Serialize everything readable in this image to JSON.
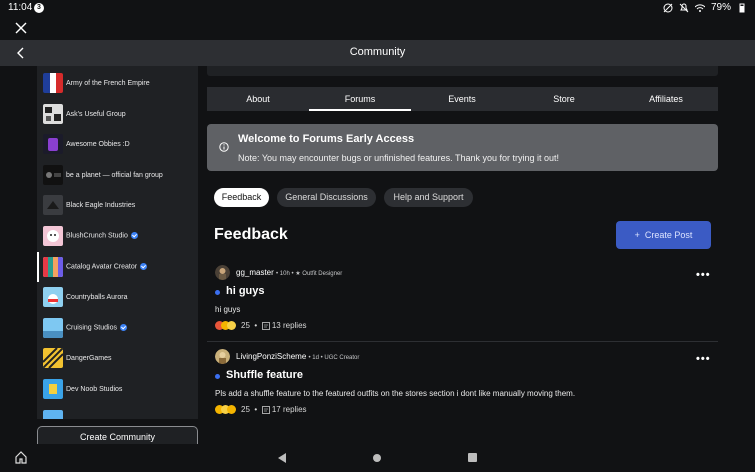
{
  "status_bar": {
    "time": "11:04",
    "notification_count": "3",
    "battery": "79%"
  },
  "header": {
    "title": "Community"
  },
  "sidebar": {
    "items": [
      {
        "label": "Army of the French Empire",
        "verified": false,
        "thumb": "flag"
      },
      {
        "label": "Ask's Useful Group",
        "verified": false,
        "thumb": "bw"
      },
      {
        "label": "Awesome Obbies :D",
        "verified": false,
        "thumb": "purple"
      },
      {
        "label": "be a planet — official fan group",
        "verified": false,
        "thumb": "dark"
      },
      {
        "label": "Black Eagle Industries",
        "verified": false,
        "thumb": "grey"
      },
      {
        "label": "BlushCrunch Studio",
        "verified": true,
        "thumb": "pink"
      },
      {
        "label": "Catalog Avatar Creator",
        "verified": true,
        "thumb": "multi",
        "active": true
      },
      {
        "label": "Countryballs Aurora",
        "verified": false,
        "thumb": "sky"
      },
      {
        "label": "Cruising Studios",
        "verified": true,
        "thumb": "lightblue"
      },
      {
        "label": "DangerGames",
        "verified": false,
        "thumb": "yellow"
      },
      {
        "label": "Dev Noob Studios",
        "verified": false,
        "thumb": "blue"
      }
    ],
    "create_button": "Create Community"
  },
  "tabs": [
    {
      "label": "About",
      "active": false
    },
    {
      "label": "Forums",
      "active": true
    },
    {
      "label": "Events",
      "active": false
    },
    {
      "label": "Store",
      "active": false
    },
    {
      "label": "Affiliates",
      "active": false
    }
  ],
  "notice": {
    "title": "Welcome to Forums Early Access",
    "body": "Note: You may encounter bugs or unfinished features. Thank you for trying it out!"
  },
  "chips": [
    {
      "label": "Feedback",
      "active": true
    },
    {
      "label": "General Discussions",
      "active": false
    },
    {
      "label": "Help and Support",
      "active": false
    }
  ],
  "feed": {
    "title": "Feedback",
    "create_post": "Create Post"
  },
  "posts": [
    {
      "user": "gg_master",
      "meta": "• 10h • ★ Outfit Designer",
      "title": "hi guys",
      "body": "hi guys",
      "reactions": "25",
      "replies": "13 replies"
    },
    {
      "user": "LivingPonziScheme",
      "meta": "• 1d • UGC Creator",
      "title": "Shuffle feature",
      "body": "Pls add a shuffle feature to the featured outfits on the stores section i dont like manually moving them.",
      "reactions": "25",
      "replies": "17 replies"
    }
  ],
  "colors": {
    "accent": "#3b5bc4",
    "dot": "#3b6ff0",
    "verified": "#3b82f6"
  }
}
